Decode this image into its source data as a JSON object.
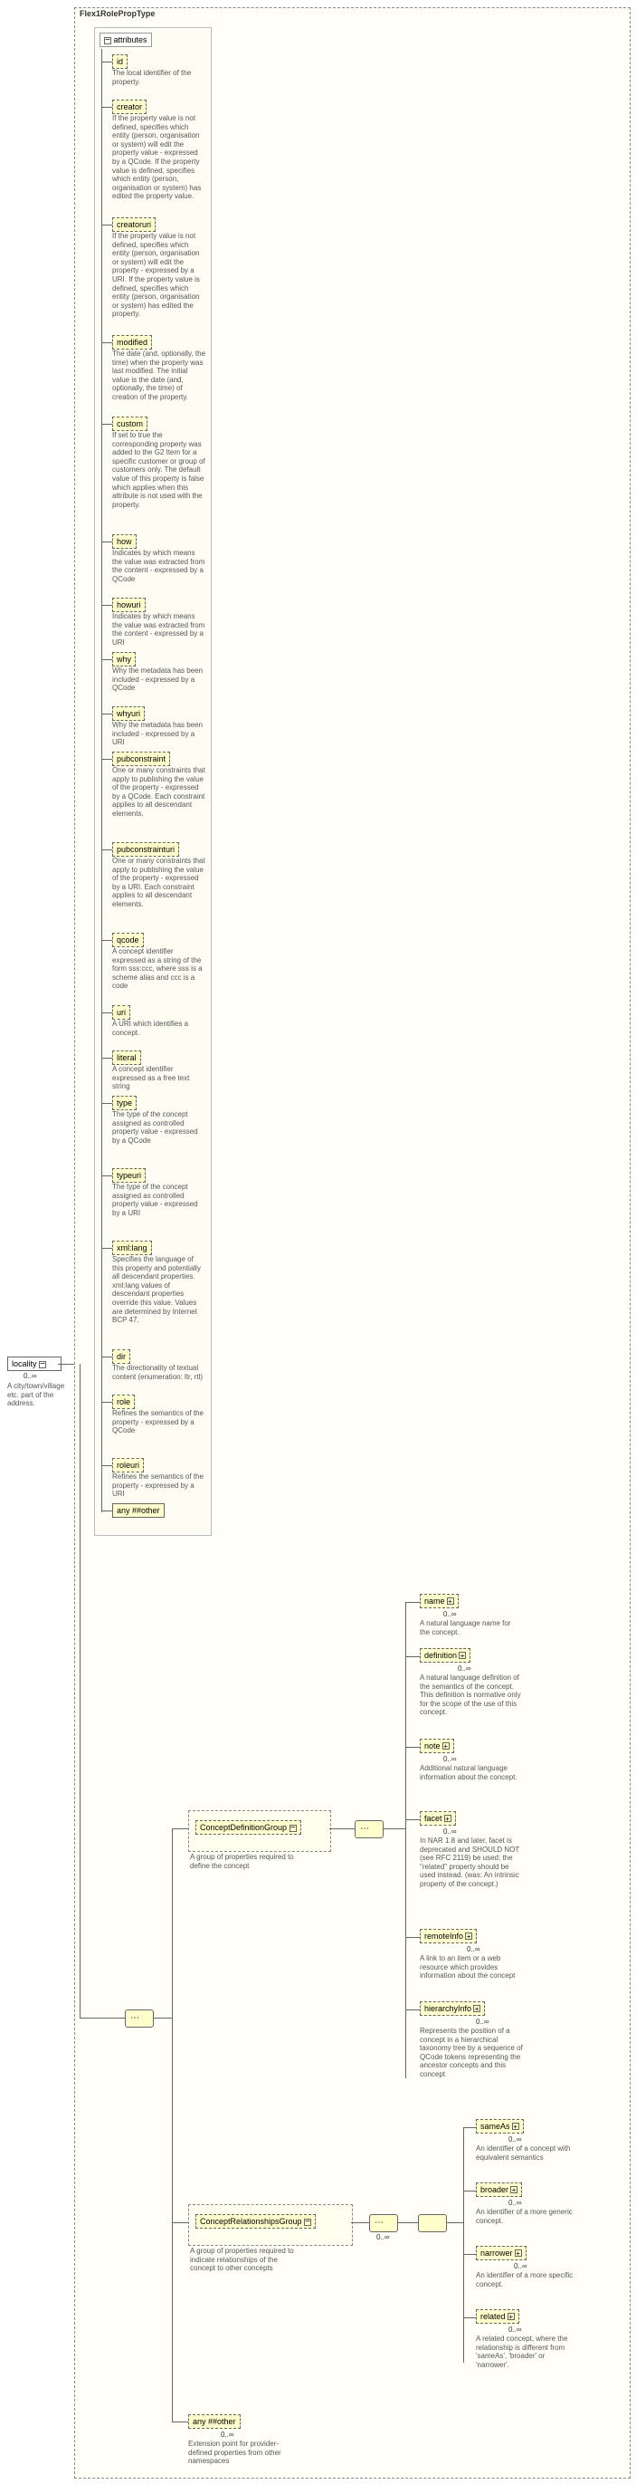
{
  "root": {
    "title": "Flex1RolePropType",
    "locality": {
      "name": "locality",
      "card": "0..∞",
      "desc": "A city/town/village etc. part of the address."
    },
    "attrs_title": "attributes",
    "attrs": [
      {
        "name": "id",
        "desc": "The local identifier of the property."
      },
      {
        "name": "creator",
        "desc": "If the property value is not defined, specifies which entity (person, organisation or system) will edit the property value - expressed by a QCode. If the property value is defined, specifies which entity (person, organisation or system) has edited the property value."
      },
      {
        "name": "creatoruri",
        "desc": "If the property value is not defined, specifies which entity (person, organisation or system) will edit the property - expressed by a URI. If the property value is defined, specifies which entity (person, organisation or system) has edited the property."
      },
      {
        "name": "modified",
        "desc": "The date (and, optionally, the time) when the property was last modified. The initial value is the date (and, optionally, the time) of creation of the property."
      },
      {
        "name": "custom",
        "desc": "If set to true the corresponding property was added to the G2 Item for a specific customer or group of customers only. The default value of this property is false which applies when this attribute is not used with the property."
      },
      {
        "name": "how",
        "desc": "Indicates by which means the value was extracted from the content - expressed by a QCode"
      },
      {
        "name": "howuri",
        "desc": "Indicates by which means the value was extracted from the content - expressed by a URI"
      },
      {
        "name": "why",
        "desc": "Why the metadata has been included - expressed by a QCode"
      },
      {
        "name": "whyuri",
        "desc": "Why the metadata has been included - expressed by a URI"
      },
      {
        "name": "pubconstraint",
        "desc": "One or many constraints that apply to publishing the value of the property - expressed by a QCode. Each constraint applies to all descendant elements."
      },
      {
        "name": "pubconstrainturi",
        "desc": "One or many constraints that apply to publishing the value of the property - expressed by a URI. Each constraint applies to all descendant elements."
      },
      {
        "name": "qcode",
        "desc": "A concept identifier expressed as a string of the form sss:ccc, where sss is a scheme alias and ccc is a code"
      },
      {
        "name": "uri",
        "desc": "A URI which identifies a concept."
      },
      {
        "name": "literal",
        "desc": "A concept identifier expressed as a free text string"
      },
      {
        "name": "type",
        "desc": "The type of the concept assigned as controlled property value - expressed by a QCode"
      },
      {
        "name": "typeuri",
        "desc": "The type of the concept assigned as controlled property value - expressed by a URI"
      },
      {
        "name": "xml:lang",
        "desc": "Specifies the language of this property and potentially all descendant properties. xml:lang values of descendant properties override this value. Values are determined by Internet BCP 47."
      },
      {
        "name": "dir",
        "desc": "The directionality of textual content (enumeration: ltr, rtl)"
      },
      {
        "name": "role",
        "desc": "Refines the semantics of the property - expressed by a QCode"
      },
      {
        "name": "roleuri",
        "desc": "Refines the semantics of the property - expressed by a URI"
      }
    ],
    "any_other": "any ##other",
    "groups": {
      "cdef": {
        "name": "ConceptDefinitionGroup",
        "desc": "A group of properties required to define the concept"
      },
      "crel": {
        "name": "ConceptRelationshipsGroup",
        "desc": "A group of properties required to indicate relationships of the concept to other concepts"
      }
    },
    "cdef_children": [
      {
        "name": "name",
        "desc": "A natural language name for the concept."
      },
      {
        "name": "definition",
        "desc": "A natural language definition of the semantics of the concept. This definition is normative only for the scope of the use of this concept."
      },
      {
        "name": "note",
        "desc": "Additional natural language information about the concept."
      },
      {
        "name": "facet",
        "desc": "In NAR 1.8 and later, facet is deprecated and SHOULD NOT (see RFC 2119) be used; the \"related\" property should be used instead. (was: An intrinsic property of the concept.)"
      },
      {
        "name": "remoteInfo",
        "desc": "A link to an item or a web resource which provides information about the concept"
      },
      {
        "name": "hierarchyInfo",
        "desc": "Represents the position of a concept in a hierarchical taxonomy tree by a sequence of QCode tokens representing the ancestor concepts and this concept"
      }
    ],
    "crel_children": [
      {
        "name": "sameAs",
        "desc": "An identifier of a concept with equivalent semantics"
      },
      {
        "name": "broader",
        "desc": "An identifier of a more generic concept."
      },
      {
        "name": "narrower",
        "desc": "An identifier of a more specific concept."
      },
      {
        "name": "related",
        "desc": "A related concept, where the relationship is different from 'sameAs', 'broader' or 'narrower'."
      }
    ],
    "ext": {
      "name": "any ##other",
      "card": "0..∞",
      "desc": "Extension point for provider-defined properties from other namespaces"
    },
    "card_inf": "0..∞"
  }
}
